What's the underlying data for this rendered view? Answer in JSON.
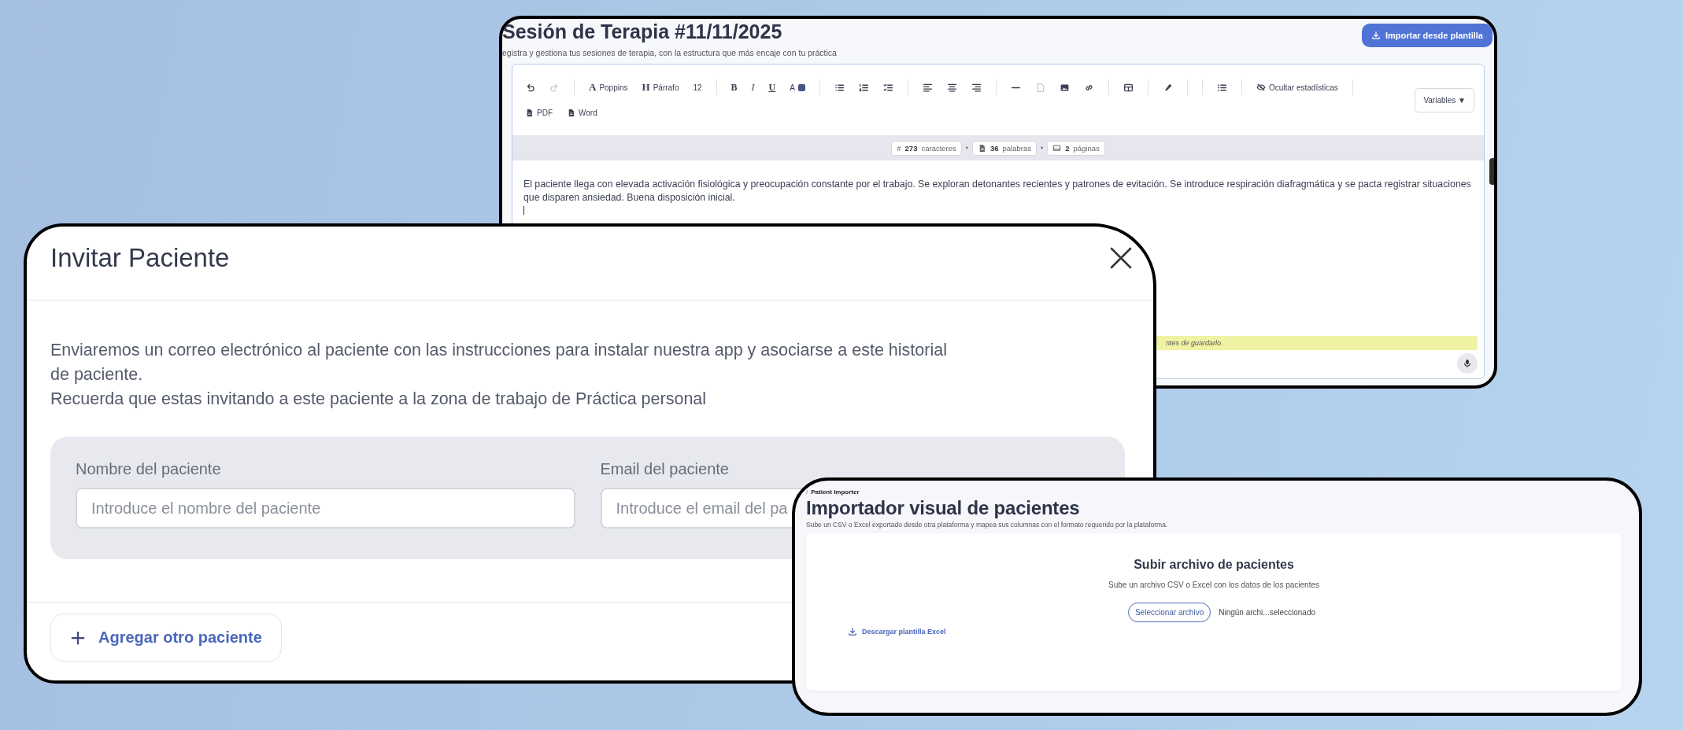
{
  "editor_window": {
    "title": "Sesión de Terapia #11/11/2025",
    "subtitle": "egistra y gestiona tus sesiones de terapia, con la estructura que más encaje con tu práctica",
    "import_button": "Importar desde plantilla",
    "font_button": {
      "glyph": "A",
      "label": "Poppins"
    },
    "heading_button": {
      "glyph": "H",
      "label": "Párrafo"
    },
    "font_size": "12",
    "format_buttons": [
      "B",
      "I",
      "U"
    ],
    "color_button": "A",
    "stats_toggle": "Ocultar estadísticas",
    "variables_button": "Variables ▼",
    "export_buttons": [
      "PDF",
      "Word"
    ],
    "stats_separators": [
      "•",
      "•"
    ],
    "stats": {
      "characters": {
        "glyph": "#",
        "value": "273",
        "label": "caracteres"
      },
      "words": {
        "value": "36",
        "label": "palabras"
      },
      "pages": {
        "value": "2",
        "label": "páginas"
      }
    },
    "body_text": "El paciente llega con elevada activación fisiológica y preocupación constante por el trabajo. Se exploran detonantes recientes y patrones de evitación. Se introduce respiración diafragmática y se pacta registrar situaciones que disparen ansiedad. Buena disposición inicial.",
    "note_text": "ntes de guardarlo."
  },
  "invite_dialog": {
    "title": "Invitar Paciente",
    "paragraphs": [
      "Enviaremos un correo electrónico al paciente con las instrucciones para instalar nuestra app y asociarse a este historial de paciente.",
      "Recuerda que estas invitando a este paciente a la zona de trabajo de Práctica personal"
    ],
    "fields": [
      {
        "label": "Nombre del paciente",
        "placeholder": "Introduce el nombre del paciente"
      },
      {
        "label": "Email del paciente",
        "placeholder": "Introduce el email del pa"
      }
    ],
    "add_button": "Agregar otro paciente"
  },
  "importer_window": {
    "breadcrumb_separator": "/",
    "breadcrumb_current": "Patient Importer",
    "title": "Importador visual de pacientes",
    "subtitle": "Sube un CSV o Excel exportado desde otra plataforma y mapea sus columnas con el formato requerido por la plataforma.",
    "upload_title": "Subir archivo de pacientes",
    "upload_description": "Sube un archivo CSV o Excel con los datos de los pacientes",
    "select_button": "Seleccionar archivo",
    "file_status": "Ningún archi...seleccionado",
    "download_link": "Descargar plantilla Excel"
  }
}
